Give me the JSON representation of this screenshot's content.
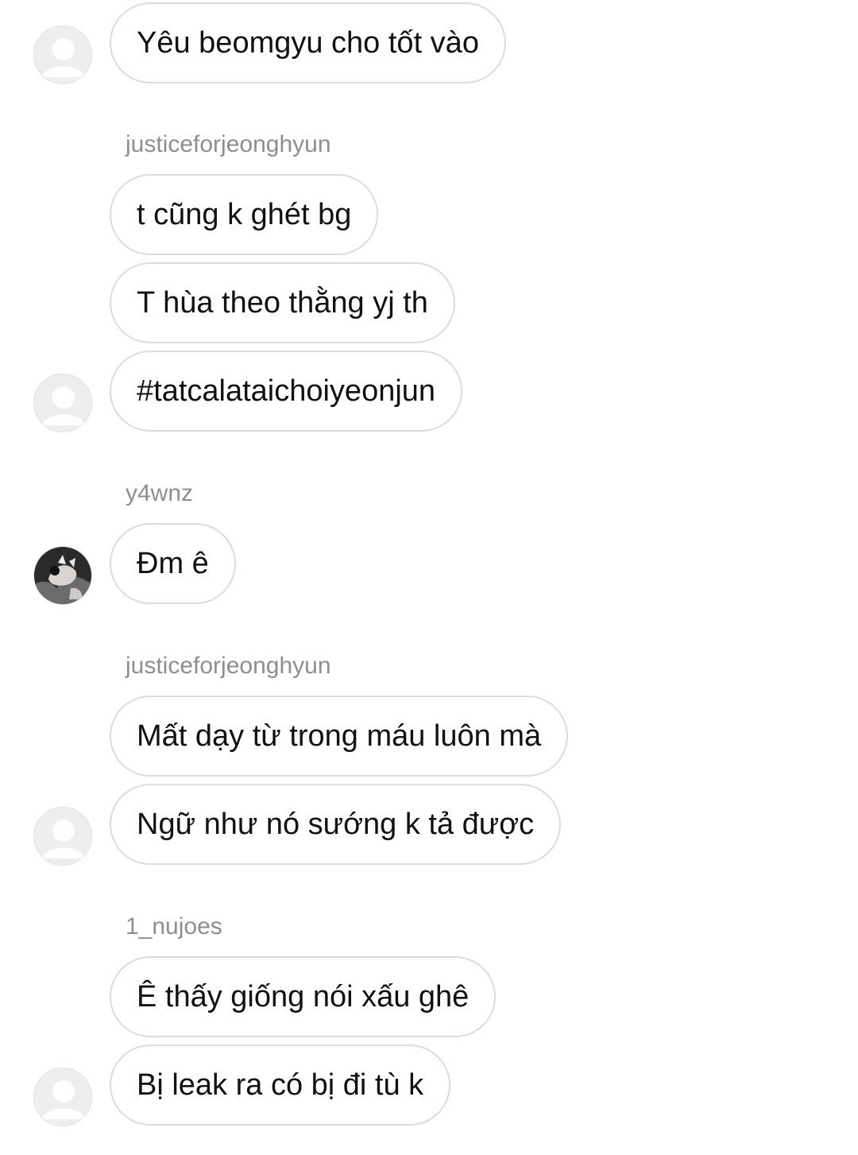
{
  "thread": {
    "groups": [
      {
        "messages": [
          "Yêu beomgyu cho tốt vào"
        ]
      },
      {
        "sender": "justiceforjeonghyun",
        "messages": [
          "t cũng k ghét bg",
          "T hùa theo thằng yj th",
          "#tatcalataichoiyeonjun"
        ]
      },
      {
        "sender": "y4wnz",
        "messages": [
          "Đm ê"
        ]
      },
      {
        "sender": "justiceforjeonghyun",
        "messages": [
          "Mất dạy từ trong máu luôn mà",
          "Ngữ như nó sướng k tả được"
        ]
      },
      {
        "sender": "1_nujoes",
        "messages": [
          "Ê thấy giống nói xấu ghê",
          "Bị leak ra có bị đi tù k"
        ]
      }
    ]
  },
  "icons": {
    "default_avatar": "default-avatar-icon",
    "photo_avatar": "profile-photo-avatar"
  },
  "colors": {
    "bubble_border": "#dcdcdc",
    "sender_text": "#8e8e8e",
    "message_text": "#111111"
  }
}
